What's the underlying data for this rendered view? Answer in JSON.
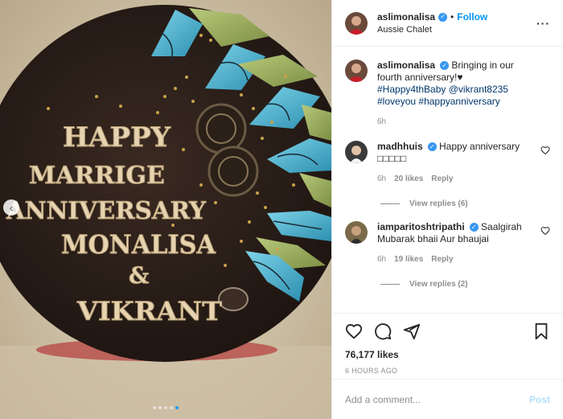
{
  "post": {
    "username": "aslimonalisa",
    "separator": "•",
    "follow_label": "Follow",
    "location": "Aussie Chalet",
    "caption": {
      "text": "Bringing in our fourth anniversary!♥",
      "hashtags_line1": "#Happy4thBaby",
      "mention": "@vikrant8235",
      "hashtags_line2": "#loveyou",
      "hashtags_line3": "#happyanniversary",
      "age": "6h"
    },
    "likes": "76,177 likes",
    "posted_time": "6 HOURS AGO"
  },
  "cake_text": {
    "line1": "HAPPY",
    "line2": "MARRIGE",
    "line3": "ANNIVERSARY",
    "line4": "MONALISA",
    "line5": "&",
    "line6": "VIKRANT"
  },
  "comments": [
    {
      "username": "madhhuis",
      "text": "Happy anniversary",
      "emoji": "□□□□□",
      "age": "6h",
      "likes": "20 likes",
      "reply_label": "Reply",
      "view_replies": "View replies (6)"
    },
    {
      "username": "iamparitoshtripathi",
      "text": "Saalgirah Mubarak bhaii Aur bhaujai",
      "age": "6h",
      "likes": "19 likes",
      "reply_label": "Reply",
      "view_replies": "View replies (2)"
    }
  ],
  "add_comment": {
    "placeholder": "Add a comment...",
    "post_label": "Post"
  },
  "carousel": {
    "total": 5,
    "active_index": 4
  },
  "colors": {
    "follow": "#0095f6",
    "verified": "#3897f0",
    "hashtag": "#00376b",
    "muted": "#8e8e8e",
    "post_disabled": "#b2dffc"
  },
  "icons": [
    "heart-icon",
    "comment-icon",
    "share-icon",
    "bookmark-icon",
    "chevron-left-icon",
    "verified-icon",
    "more-icon"
  ]
}
